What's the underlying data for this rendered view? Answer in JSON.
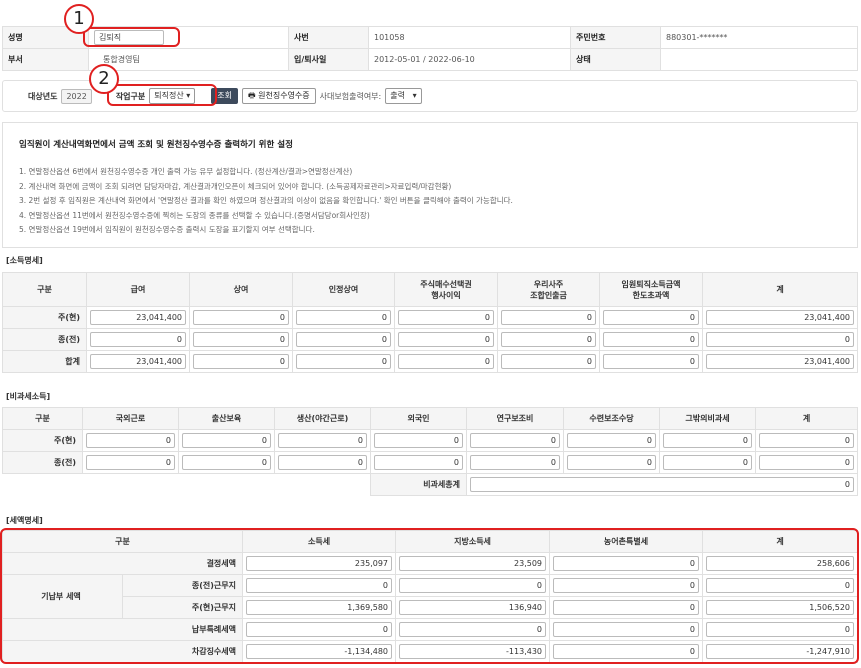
{
  "header": {
    "name_label": "성명",
    "name_value": "김퇴직",
    "emp_no_label": "사번",
    "emp_no_value": "101058",
    "rrn_label": "주민번호",
    "rrn_value": "880301-*******",
    "dept_label": "부서",
    "dept_value": "통합경영팀",
    "dates_label": "입/퇴사일",
    "dates_value": "2012-05-01 / 2022-06-10",
    "status_label": "상태",
    "status_value": ""
  },
  "annotations": {
    "one": "1",
    "two": "2"
  },
  "toolbar": {
    "year_label": "대상년도",
    "year_value": "2022",
    "worktype_label": "작업구분",
    "worktype_value": "퇴직정산",
    "search_button": "조회",
    "print_button": "원천징수영수증",
    "print_option_label": "사대보험출력여부:",
    "print_option_value": "출력"
  },
  "info": {
    "title": "임직원이 계산내역화면에서 금액 조회 및 원천징수영수증 출력하기 위한 설정",
    "lines": [
      "1. 연말정산옵션 6번에서 원천징수영수증 개인 출력 가능 유무 설정합니다. (정산계산/결과>연말정산계산)",
      "2. 계산내역 화면에 금액이 조회 되려면 담당자마감, 계산결과개인오픈이 체크되어 있어야 합니다. (소득공제자료관리>자료입력/마감현황)",
      "3. 2번 설정 후 임직원은 계산내역 화면에서 '연말정산 결과를 확인 하였으며 정산결과의 이상이 없음을 확인합니다.' 확인 버튼을 클릭해야 출력이 가능합니다.",
      "4. 연말정산옵션 11번에서 원천징수영수증에 찍히는 도장의 종류를 선택할 수 있습니다.(증명서담당or회사인장)",
      "5. 연말정산옵션 19번에서 임직원이 원천징수영수증 출력시 도장을 표기할지 여부 선택합니다."
    ]
  },
  "income": {
    "title": "[소득명세]",
    "columns": [
      "구분",
      "급여",
      "상여",
      "인정상여",
      "주식매수선택권\n행사이익",
      "우리사주\n조합인출금",
      "임원퇴직소득금액\n한도초과액",
      "계"
    ],
    "rows": [
      {
        "label": "주(현)",
        "values": [
          "23,041,400",
          "0",
          "0",
          "0",
          "0",
          "0",
          "23,041,400"
        ]
      },
      {
        "label": "종(전)",
        "values": [
          "0",
          "0",
          "0",
          "0",
          "0",
          "0",
          "0"
        ]
      },
      {
        "label": "합계",
        "values": [
          "23,041,400",
          "0",
          "0",
          "0",
          "0",
          "0",
          "23,041,400"
        ]
      }
    ]
  },
  "nontax": {
    "title": "[비과세소득]",
    "columns": [
      "구분",
      "국외근로",
      "출산보육",
      "생산(야간근로)",
      "외국인",
      "연구보조비",
      "수련보조수당",
      "그밖의비과세",
      "계"
    ],
    "rows": [
      {
        "label": "주(현)",
        "values": [
          "0",
          "0",
          "0",
          "0",
          "0",
          "0",
          "0",
          "0"
        ]
      },
      {
        "label": "종(전)",
        "values": [
          "0",
          "0",
          "0",
          "0",
          "0",
          "0",
          "0",
          "0"
        ]
      }
    ],
    "total_label": "비과세총계",
    "total_value": "0"
  },
  "tax": {
    "title": "[세액명세]",
    "columns": [
      "구분",
      "소득세",
      "지방소득세",
      "농어촌특별세",
      "계"
    ],
    "group_label": "기납부 세액",
    "rows": [
      {
        "label": "결정세액",
        "values": [
          "235,097",
          "23,509",
          "0",
          "258,606"
        ]
      },
      {
        "label": "종(전)근무지",
        "values": [
          "0",
          "0",
          "0",
          "0"
        ]
      },
      {
        "label": "주(현)근무지",
        "values": [
          "1,369,580",
          "136,940",
          "0",
          "1,506,520"
        ]
      },
      {
        "label": "납부특례세액",
        "values": [
          "0",
          "0",
          "0",
          "0"
        ]
      },
      {
        "label": "차감징수세액",
        "values": [
          "-1,134,480",
          "-113,430",
          "0",
          "-1,247,910"
        ]
      }
    ]
  }
}
